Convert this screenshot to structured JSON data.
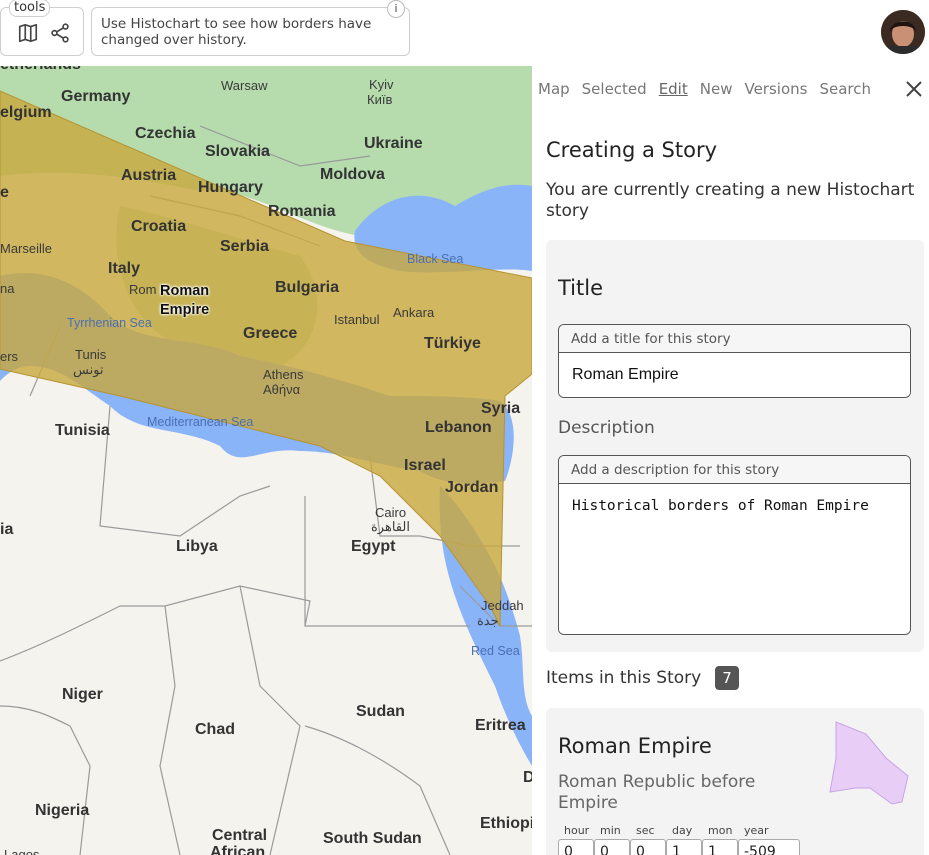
{
  "toolbar": {
    "tools_label": "tools",
    "info_text": "Use Histochart to see how borders have changed over history.",
    "info_button": "i"
  },
  "map": {
    "empire_label_line1": "Roman",
    "empire_label_line2": "Empire",
    "countries": [
      {
        "name": "etherlands",
        "cls": "country"
      },
      {
        "name": "Germany",
        "cls": "country"
      },
      {
        "name": "elgium",
        "cls": "country"
      },
      {
        "name": "Czechia",
        "cls": "country"
      },
      {
        "name": "Slovakia",
        "cls": "country"
      },
      {
        "name": "Ukraine",
        "cls": "country"
      },
      {
        "name": "Moldova",
        "cls": "country"
      },
      {
        "name": "Austria",
        "cls": "country"
      },
      {
        "name": "Hungary",
        "cls": "country"
      },
      {
        "name": "Romania",
        "cls": "country"
      },
      {
        "name": "Croatia",
        "cls": "country"
      },
      {
        "name": "Serbia",
        "cls": "country"
      },
      {
        "name": "Italy",
        "cls": "country"
      },
      {
        "name": "Bulgaria",
        "cls": "country"
      },
      {
        "name": "Greece",
        "cls": "country"
      },
      {
        "name": "Türkiye",
        "cls": "country"
      },
      {
        "name": "Syria",
        "cls": "country"
      },
      {
        "name": "Lebanon",
        "cls": "country"
      },
      {
        "name": "Israel",
        "cls": "country"
      },
      {
        "name": "Jordan",
        "cls": "country"
      },
      {
        "name": "Tunisia",
        "cls": "country"
      },
      {
        "name": "Libya",
        "cls": "country"
      },
      {
        "name": "Egypt",
        "cls": "country"
      },
      {
        "name": "ia",
        "cls": "country"
      },
      {
        "name": "Niger",
        "cls": "country"
      },
      {
        "name": "Chad",
        "cls": "country"
      },
      {
        "name": "Sudan",
        "cls": "country"
      },
      {
        "name": "Eritrea",
        "cls": "country"
      },
      {
        "name": "Nigeria",
        "cls": "country"
      },
      {
        "name": "Central",
        "cls": "country"
      },
      {
        "name": "African",
        "cls": "country"
      },
      {
        "name": "South Sudan",
        "cls": "country"
      },
      {
        "name": "Ethiopi",
        "cls": "country"
      },
      {
        "name": "D",
        "cls": "country"
      },
      {
        "name": "e",
        "cls": "country"
      }
    ],
    "cities": [
      {
        "name": "Warsaw"
      },
      {
        "name": "Kyiv"
      },
      {
        "name": "Київ"
      },
      {
        "name": "Marseille"
      },
      {
        "name": "Rom"
      },
      {
        "name": "Istanbul"
      },
      {
        "name": "Ankara"
      },
      {
        "name": "Athens"
      },
      {
        "name": "Αθήνα"
      },
      {
        "name": "Tunis"
      },
      {
        "name": "تونس"
      },
      {
        "name": "Cairo"
      },
      {
        "name": "القاهرة"
      },
      {
        "name": "Jeddah"
      },
      {
        "name": "جدة"
      },
      {
        "name": "Lagos"
      },
      {
        "name": "na"
      },
      {
        "name": "ers"
      }
    ],
    "seas": [
      {
        "name": "Black Sea"
      },
      {
        "name": "Tyrrhenian Sea"
      },
      {
        "name": "Mediterranean Sea"
      },
      {
        "name": "Red Sea"
      }
    ],
    "colors": {
      "land": "#f5f3ee",
      "forest": "#a7d3a0",
      "water": "#8ab4f8",
      "empire_fill": "#c8a83c",
      "border": "#8f8f8f"
    }
  },
  "panel": {
    "tabs": [
      {
        "label": "Map",
        "active": false
      },
      {
        "label": "Selected",
        "active": false
      },
      {
        "label": "Edit",
        "active": true
      },
      {
        "label": "New",
        "active": false
      },
      {
        "label": "Versions",
        "active": false
      },
      {
        "label": "Search",
        "active": false
      }
    ],
    "heading": "Creating a Story",
    "subheading": "You are currently creating a new Histochart story",
    "form": {
      "title_label": "Title",
      "title_hint": "Add a title for this story",
      "title_value": "Roman Empire",
      "description_label": "Description",
      "description_hint": "Add a description for this story",
      "description_value": "Historical borders of Roman Empire"
    },
    "items_label": "Items in this Story",
    "items_count": "7",
    "item": {
      "name": "Roman Empire",
      "description": "Roman Republic before Empire",
      "shape_color": "#e8cdf7",
      "time": [
        {
          "label": "hour",
          "value": "0"
        },
        {
          "label": "min",
          "value": "0"
        },
        {
          "label": "sec",
          "value": "0"
        },
        {
          "label": "day",
          "value": "1"
        },
        {
          "label": "mon",
          "value": "1"
        },
        {
          "label": "year",
          "value": "-509"
        }
      ]
    }
  }
}
